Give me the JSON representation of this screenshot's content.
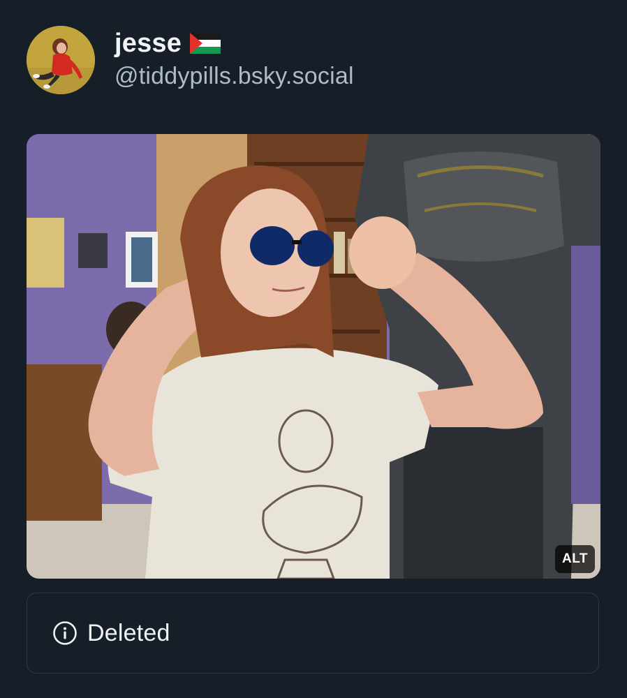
{
  "author": {
    "display_name": "jesse",
    "flag_icon": "palestine-flag-icon",
    "handle": "@tiddypills.bsky.social"
  },
  "media": {
    "alt_label": "ALT"
  },
  "quoted_post": {
    "icon": "info-circle-icon",
    "status_label": "Deleted"
  },
  "colors": {
    "background": "#161e27",
    "text_primary": "#f1f3f5",
    "text_secondary": "#aebbc9",
    "card_border": "#2e3a48"
  }
}
